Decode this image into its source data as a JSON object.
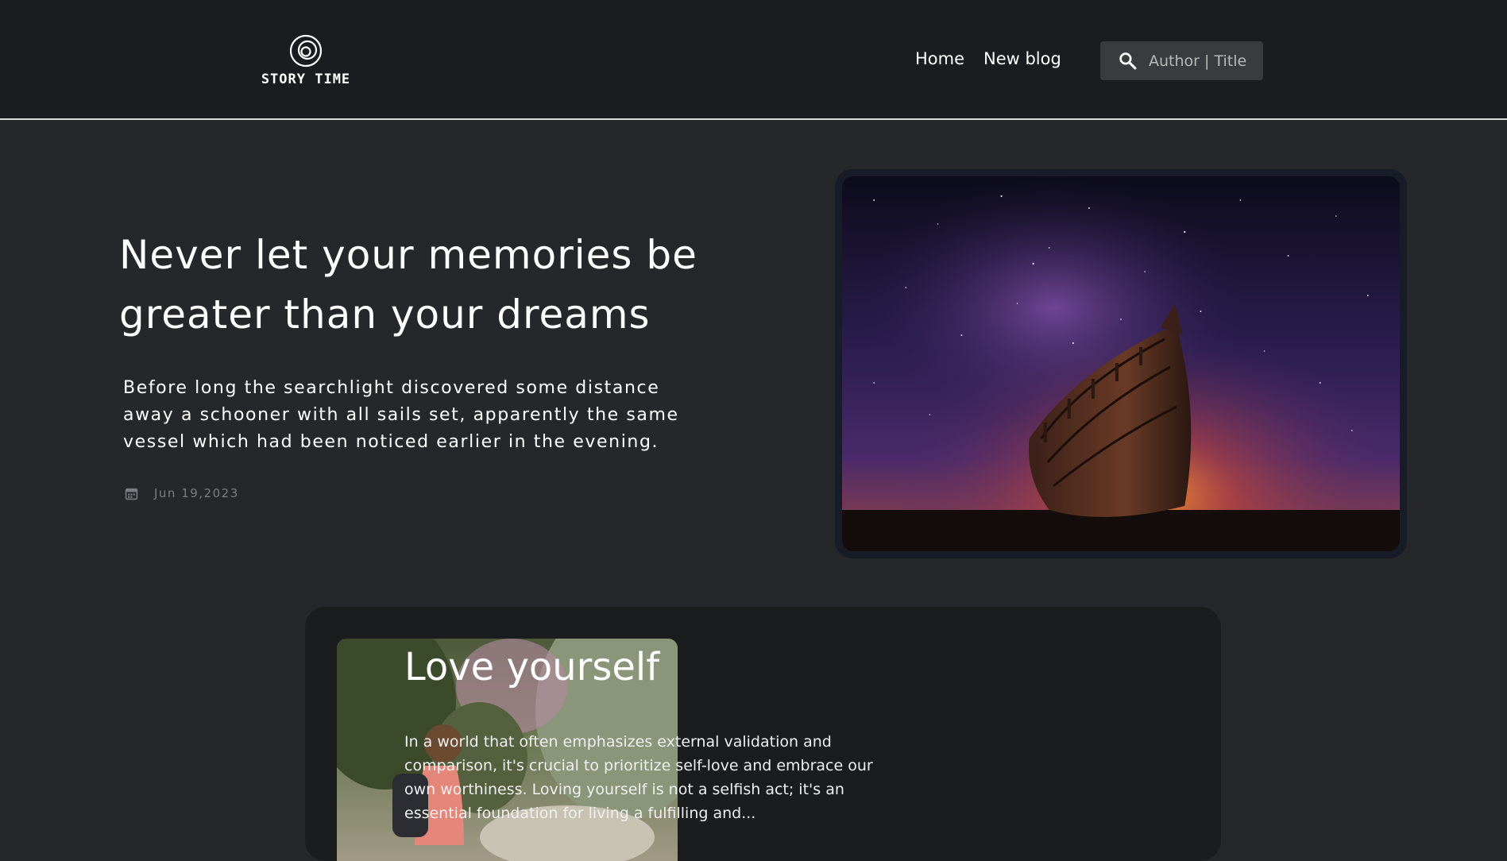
{
  "header": {
    "logo_text": "STORY TIME",
    "nav": {
      "home_label": "Home",
      "new_blog_label": "New blog"
    },
    "search": {
      "placeholder": "Author | Title",
      "icon": "search-icon"
    }
  },
  "hero": {
    "title": "Never let your memories be greater than your dreams",
    "text": "Before long the searchlight discovered some distance away a schooner with all sails set, apparently the same vessel which had been noticed earlier in the evening.",
    "date": "Jun 19,2023",
    "date_icon": "calendar-icon",
    "image": "night-sky-boat-image"
  },
  "posts": [
    {
      "title": "Love yourself",
      "excerpt": "In a world that often emphasizes external validation and comparison, it's crucial to prioritize self-love and embrace our own worthiness. Loving yourself is not a selfish act; it's an essential foundation for living a fulfilling and...",
      "image": "child-in-forest-image"
    }
  ],
  "colors": {
    "page_bg": "#25272b",
    "header_bg": "#1b1c1f",
    "card_bg": "#1b1c1e",
    "search_bg": "#3a3b3e",
    "muted_text": "#7a7d82"
  }
}
